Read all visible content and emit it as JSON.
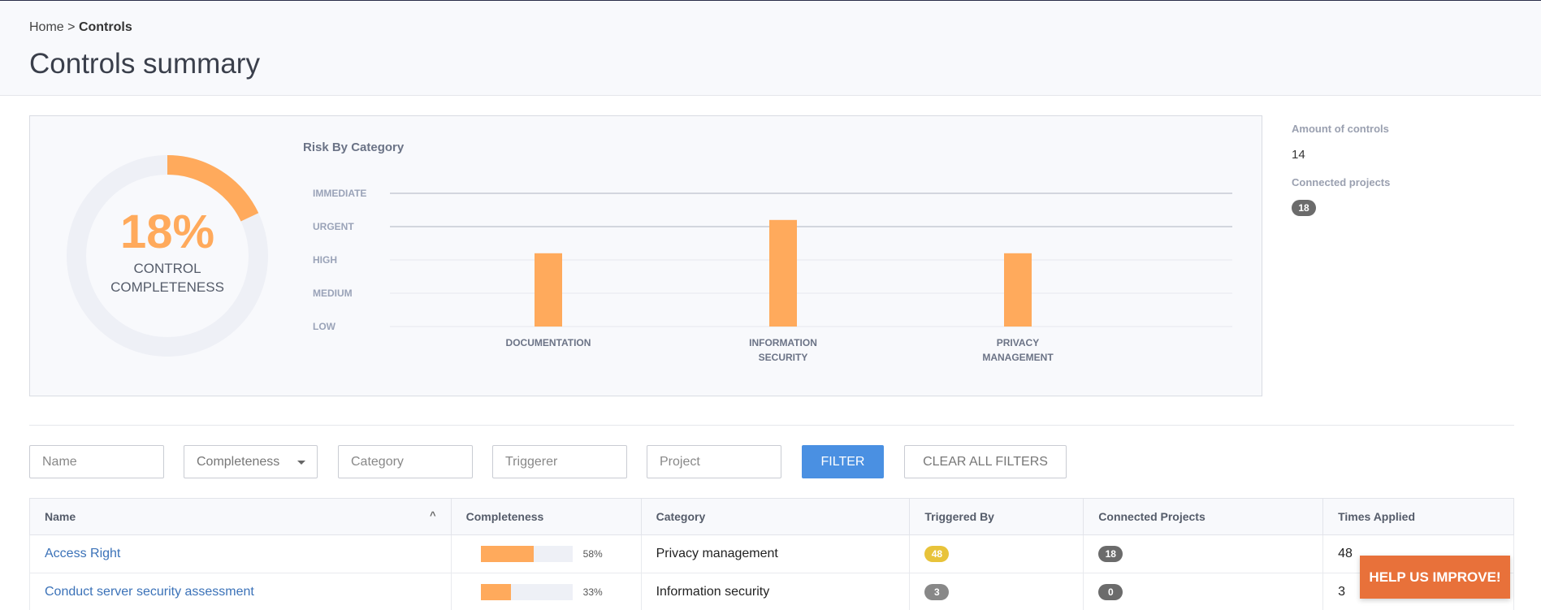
{
  "breadcrumb": {
    "home": "Home",
    "separator": ">",
    "current": "Controls"
  },
  "page_title": "Controls summary",
  "completeness": {
    "percent_label": "18%",
    "value": 0.18,
    "label_line1": "CONTROL",
    "label_line2": "COMPLETENESS"
  },
  "risk_chart": {
    "title": "Risk By Category",
    "levels": [
      "LOW",
      "MEDIUM",
      "HIGH",
      "URGENT",
      "IMMEDIATE"
    ],
    "categories": [
      {
        "line1": "DOCUMENTATION",
        "line2": ""
      },
      {
        "line1": "INFORMATION",
        "line2": "SECURITY"
      },
      {
        "line1": "PRIVACY",
        "line2": "MANAGEMENT"
      }
    ]
  },
  "chart_data": {
    "type": "bar",
    "title": "Risk By Category",
    "categories": [
      "DOCUMENTATION",
      "INFORMATION SECURITY",
      "PRIVACY MANAGEMENT"
    ],
    "y_levels": [
      "LOW",
      "MEDIUM",
      "HIGH",
      "URGENT",
      "IMMEDIATE"
    ],
    "values": [
      "HIGH",
      "URGENT",
      "HIGH"
    ],
    "value_levels": [
      2.2,
      3.2,
      2.2
    ],
    "grid": true
  },
  "stats": {
    "amount_label": "Amount of controls",
    "amount_value": "14",
    "projects_label": "Connected projects",
    "projects_value": "18"
  },
  "filters": {
    "name_placeholder": "Name",
    "completeness_label": "Completeness",
    "category_placeholder": "Category",
    "triggerer_placeholder": "Triggerer",
    "project_placeholder": "Project",
    "filter_button": "FILTER",
    "clear_button": "CLEAR ALL FILTERS"
  },
  "table": {
    "headers": [
      "Name",
      "Completeness",
      "Category",
      "Triggered By",
      "Connected Projects",
      "Times Applied"
    ],
    "rows": [
      {
        "name": "Access Right",
        "completeness": 0.58,
        "completeness_label": "58%",
        "category": "Privacy management",
        "triggered_by": "48",
        "connected_projects": "18",
        "times_applied": "48"
      },
      {
        "name": "Conduct server security assessment",
        "completeness": 0.33,
        "completeness_label": "33%",
        "category": "Information security",
        "triggered_by": "3",
        "connected_projects": "0",
        "times_applied": "3"
      }
    ]
  },
  "help_button": "HELP US IMPROVE!",
  "colors": {
    "accent_orange": "#ffaa5c",
    "primary_blue": "#4a90e2",
    "help_orange": "#e8713a",
    "badge_yellow": "#e8c33a"
  }
}
